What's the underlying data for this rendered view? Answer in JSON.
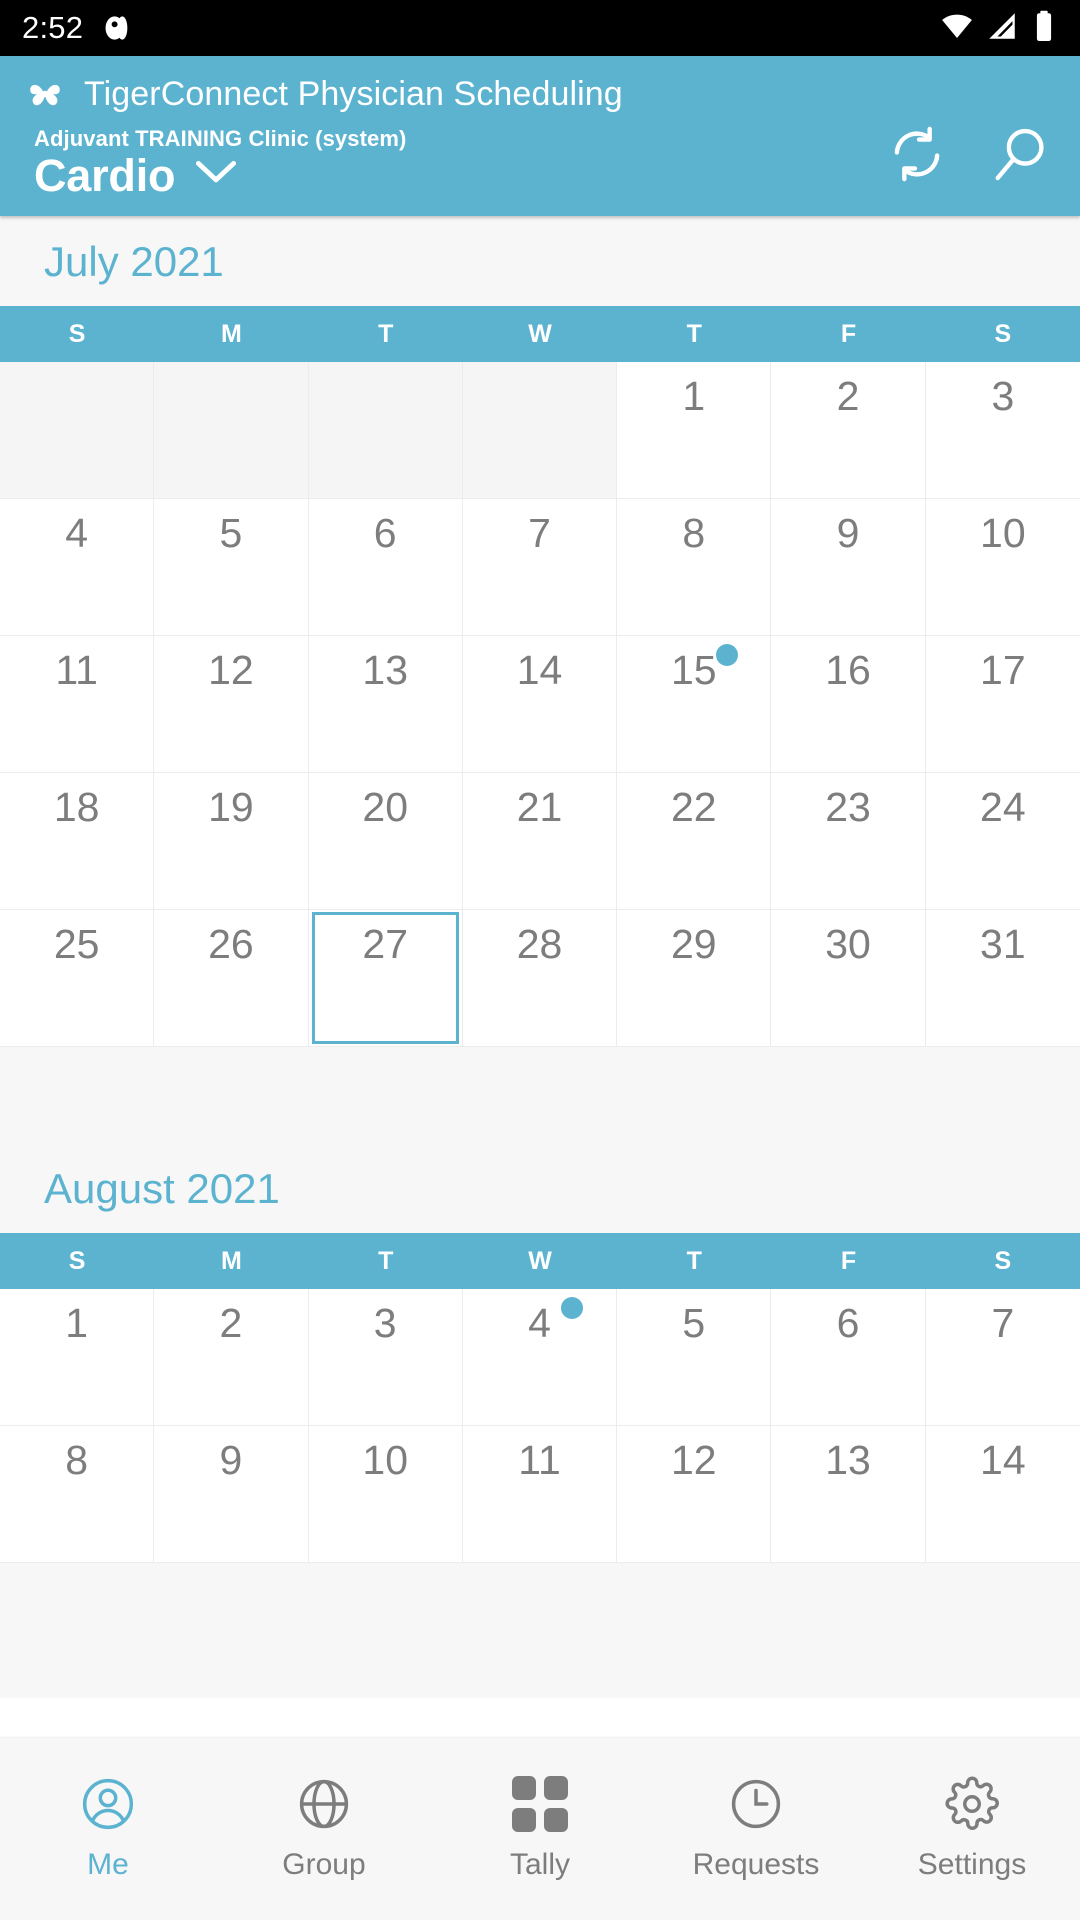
{
  "status_bar": {
    "time": "2:52",
    "notification_icon": "notification-badge-icon",
    "wifi_icon": "wifi-icon",
    "signal_icon": "cellular-signal-icon",
    "battery_icon": "battery-full-icon"
  },
  "app_bar": {
    "logo_icon": "tigerconnect-clover-logo-icon",
    "title": "TigerConnect Physician Scheduling",
    "organization": "Adjuvant TRAINING Clinic (system)",
    "department": "Cardio",
    "dropdown_icon": "chevron-down-icon",
    "refresh_icon": "refresh-icon",
    "search_icon": "search-icon",
    "accent_color": "#5bb3d0"
  },
  "calendar": {
    "weekday_headers": [
      "S",
      "M",
      "T",
      "W",
      "T",
      "F",
      "S"
    ],
    "selected_day": 27,
    "months": [
      {
        "title": "July 2021",
        "weeks": [
          [
            null,
            null,
            null,
            null,
            1,
            2,
            3
          ],
          [
            4,
            5,
            6,
            7,
            8,
            9,
            10
          ],
          [
            11,
            12,
            13,
            14,
            15,
            16,
            17
          ],
          [
            18,
            19,
            20,
            21,
            22,
            23,
            24
          ],
          [
            25,
            26,
            27,
            28,
            29,
            30,
            31
          ]
        ],
        "marked_days": [
          15
        ],
        "selected": 27
      },
      {
        "title": "August 2021",
        "weeks": [
          [
            1,
            2,
            3,
            4,
            5,
            6,
            7
          ],
          [
            8,
            9,
            10,
            11,
            12,
            13,
            14
          ]
        ],
        "marked_days": [
          4
        ],
        "selected": null
      }
    ]
  },
  "bottom_nav": {
    "items": [
      {
        "label": "Me",
        "icon": "person-circle-icon",
        "active": true
      },
      {
        "label": "Group",
        "icon": "globe-icon",
        "active": false
      },
      {
        "label": "Tally",
        "icon": "grid-four-dots-icon",
        "active": false
      },
      {
        "label": "Requests",
        "icon": "clock-icon",
        "active": false
      },
      {
        "label": "Settings",
        "icon": "gear-icon",
        "active": false
      }
    ]
  }
}
